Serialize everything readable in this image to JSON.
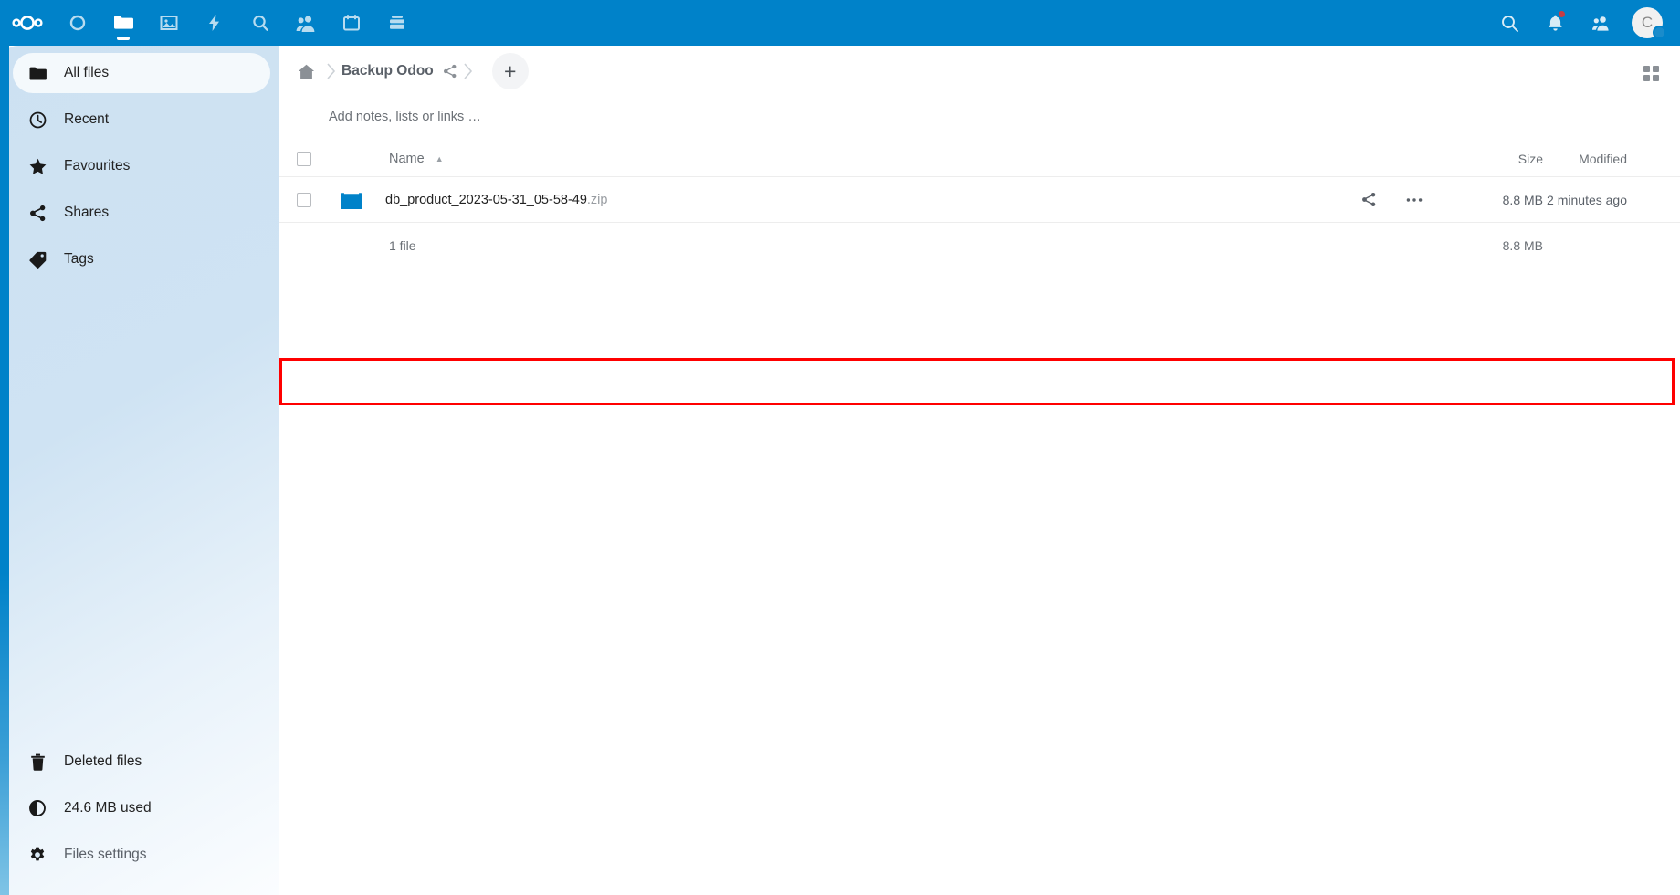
{
  "app": {
    "name": "Nextcloud Files",
    "brand_color": "#0082c9",
    "highlight_color": "#ff0000"
  },
  "header": {
    "logo": "nextcloud-logo",
    "apps": [
      {
        "name": "dashboard",
        "icon": "circle-icon",
        "label": "Dashboard",
        "active": false
      },
      {
        "name": "files",
        "icon": "folder-icon",
        "label": "Files",
        "active": true
      },
      {
        "name": "photos",
        "icon": "photos-icon",
        "label": "Photos",
        "active": false
      },
      {
        "name": "activity",
        "icon": "lightning-icon",
        "label": "Activity",
        "active": false
      },
      {
        "name": "search",
        "icon": "magnifier-icon",
        "label": "Unified search",
        "active": false
      },
      {
        "name": "contacts",
        "icon": "contacts-icon",
        "label": "Contacts",
        "active": false
      },
      {
        "name": "calendar",
        "icon": "calendar-icon",
        "label": "Calendar",
        "active": false
      },
      {
        "name": "deck",
        "icon": "deck-icon",
        "label": "Deck",
        "active": false
      }
    ],
    "right": {
      "search_icon": "search-icon",
      "notifications_icon": "bell-icon",
      "notifications_badge": true,
      "contacts_icon": "contacts-menu-icon",
      "avatar_initial": "C",
      "avatar_status": "online"
    }
  },
  "sidebar": {
    "items": [
      {
        "label": "All files",
        "icon": "folder-icon",
        "active": true
      },
      {
        "label": "Recent",
        "icon": "clock-icon",
        "active": false
      },
      {
        "label": "Favourites",
        "icon": "star-icon",
        "active": false
      },
      {
        "label": "Shares",
        "icon": "share-icon",
        "active": false
      },
      {
        "label": "Tags",
        "icon": "tag-icon",
        "active": false
      }
    ],
    "bottom_items": [
      {
        "label": "Deleted files",
        "icon": "trash-icon"
      },
      {
        "label": "24.6 MB used",
        "icon": "quota-pie-icon"
      },
      {
        "label": "Files settings",
        "icon": "gear-icon"
      }
    ]
  },
  "breadcrumb": {
    "home_icon": "home-icon",
    "separator": "›",
    "current": "Backup Odoo",
    "share_icon": "share-icon",
    "new_label": "+",
    "view_toggle_icon": "grid-view-icon"
  },
  "notes": {
    "placeholder": "Add notes, lists or links …"
  },
  "table": {
    "columns": {
      "name": "Name",
      "size": "Size",
      "modified": "Modified"
    },
    "sort_indicator": "▲",
    "rows": [
      {
        "icon": "zip-archive-icon",
        "basename": "db_product_2023-05-31_05-58-49",
        "extension": ".zip",
        "size": "8.8 MB",
        "modified": "2 minutes ago",
        "share_icon": "share-icon",
        "menu_icon": "ellipsis-icon",
        "highlighted": true
      }
    ],
    "summary": {
      "count": "1 file",
      "total_size": "8.8 MB"
    }
  }
}
